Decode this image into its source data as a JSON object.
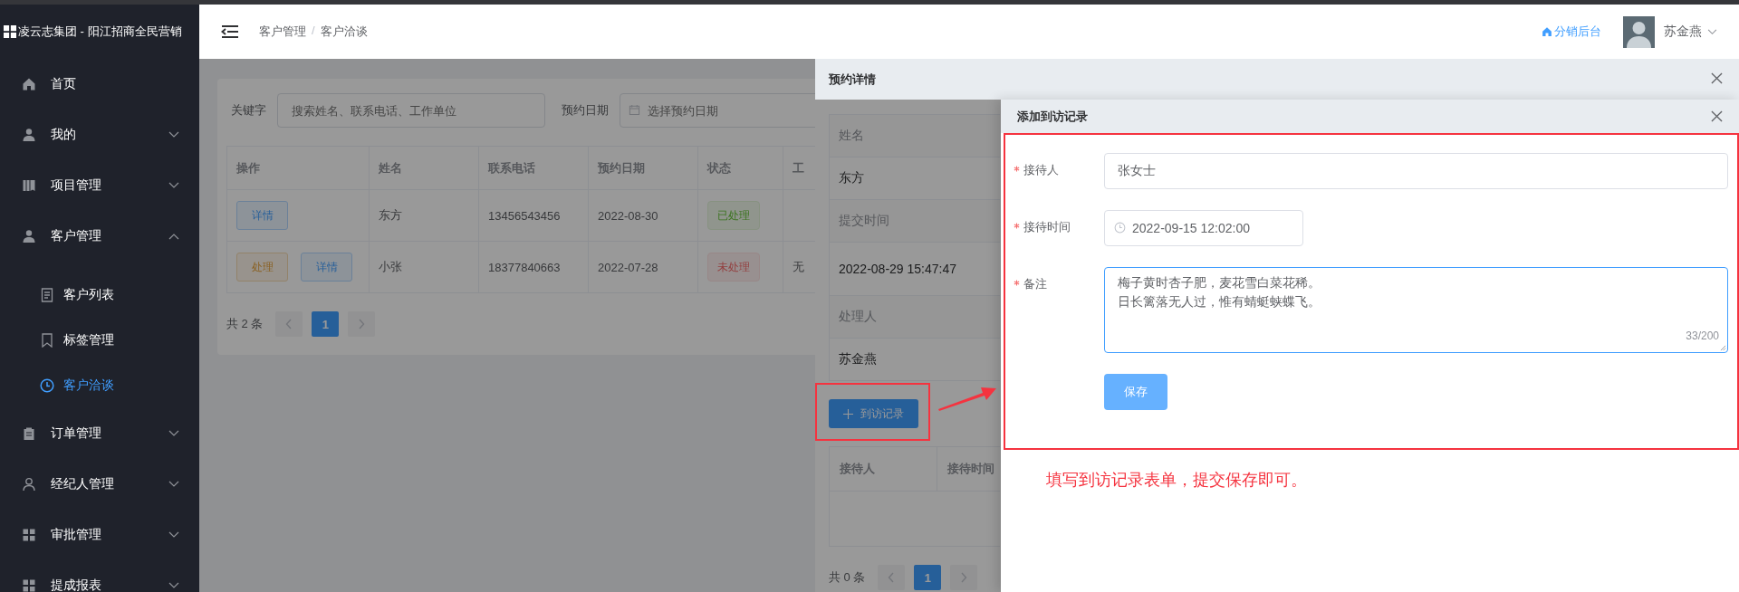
{
  "app": {
    "logo_text": "凌云志集团 - 阳江招商全民营销"
  },
  "sidebar": {
    "items": [
      {
        "label": "首页",
        "expandable": false
      },
      {
        "label": "我的",
        "expandable": true,
        "expanded": false
      },
      {
        "label": "项目管理",
        "expandable": true,
        "expanded": false
      },
      {
        "label": "客户管理",
        "expandable": true,
        "expanded": true,
        "children": [
          {
            "label": "客户列表",
            "selected": false
          },
          {
            "label": "标签管理",
            "selected": false
          },
          {
            "label": "客户洽谈",
            "selected": true
          }
        ]
      },
      {
        "label": "订单管理",
        "expandable": true,
        "expanded": false
      },
      {
        "label": "经纪人管理",
        "expandable": true,
        "expanded": false
      },
      {
        "label": "审批管理",
        "expandable": true,
        "expanded": false
      },
      {
        "label": "提成报表",
        "expandable": true,
        "expanded": false
      }
    ]
  },
  "header": {
    "breadcrumb": [
      "客户管理",
      "客户洽谈"
    ],
    "separator": "/",
    "link": "分销后台",
    "user": "苏金燕"
  },
  "filters": {
    "keyword_label": "关键字",
    "keyword_placeholder": "搜索姓名、联系电话、工作单位",
    "date_label": "预约日期",
    "date_placeholder": "选择预约日期"
  },
  "table": {
    "columns": [
      "操作",
      "姓名",
      "联系电话",
      "预约日期",
      "状态",
      "工"
    ],
    "rows": [
      {
        "actions": [
          {
            "label": "详情",
            "kind": "detail"
          }
        ],
        "name": "东方",
        "phone": "13456543456",
        "date": "2022-08-30",
        "status": {
          "text": "已处理",
          "kind": "done"
        }
      },
      {
        "actions": [
          {
            "label": "处理",
            "kind": "process"
          },
          {
            "label": "详情",
            "kind": "detail"
          }
        ],
        "name": "小张",
        "phone": "18377840663",
        "date": "2022-07-28",
        "status": {
          "text": "未处理",
          "kind": "pending"
        },
        "column_6": "无"
      }
    ]
  },
  "pagination": {
    "total": "共 2 条",
    "pages": [
      {
        "label": "1",
        "selected": true
      }
    ]
  },
  "detail_drawer": {
    "title": "预约详情",
    "fields": [
      {
        "label": "姓名",
        "value": "东方"
      },
      {
        "label": "提交时间",
        "value": "2022-08-29 15:47:47"
      },
      {
        "label": "处理人",
        "value": "苏金燕"
      }
    ],
    "add_button": "到访记录",
    "table_columns": [
      "接待人",
      "接待时间"
    ],
    "pagination": {
      "total": "共 0 条",
      "pages": [
        {
          "label": "1",
          "selected": true
        }
      ]
    }
  },
  "visit_drawer": {
    "title": "添加到访记录",
    "fields": [
      {
        "label": "接待人",
        "required": true,
        "kind": "text",
        "value": "张女士",
        "focused": false
      },
      {
        "label": "接待时间",
        "required": true,
        "kind": "datetime",
        "value": "2022-09-15 12:02:00",
        "focused": false
      },
      {
        "label": "备注",
        "required": true,
        "kind": "textarea",
        "value": "梅子黄时杏子肥，麦花雪白菜花稀。日长篱落无人过，惟有蜻蜓蛱蝶飞。",
        "counter": "33/200",
        "focused": true
      }
    ],
    "save_button": "保存"
  },
  "annotation": {
    "text": "填写到访记录表单，提交保存即可。"
  }
}
